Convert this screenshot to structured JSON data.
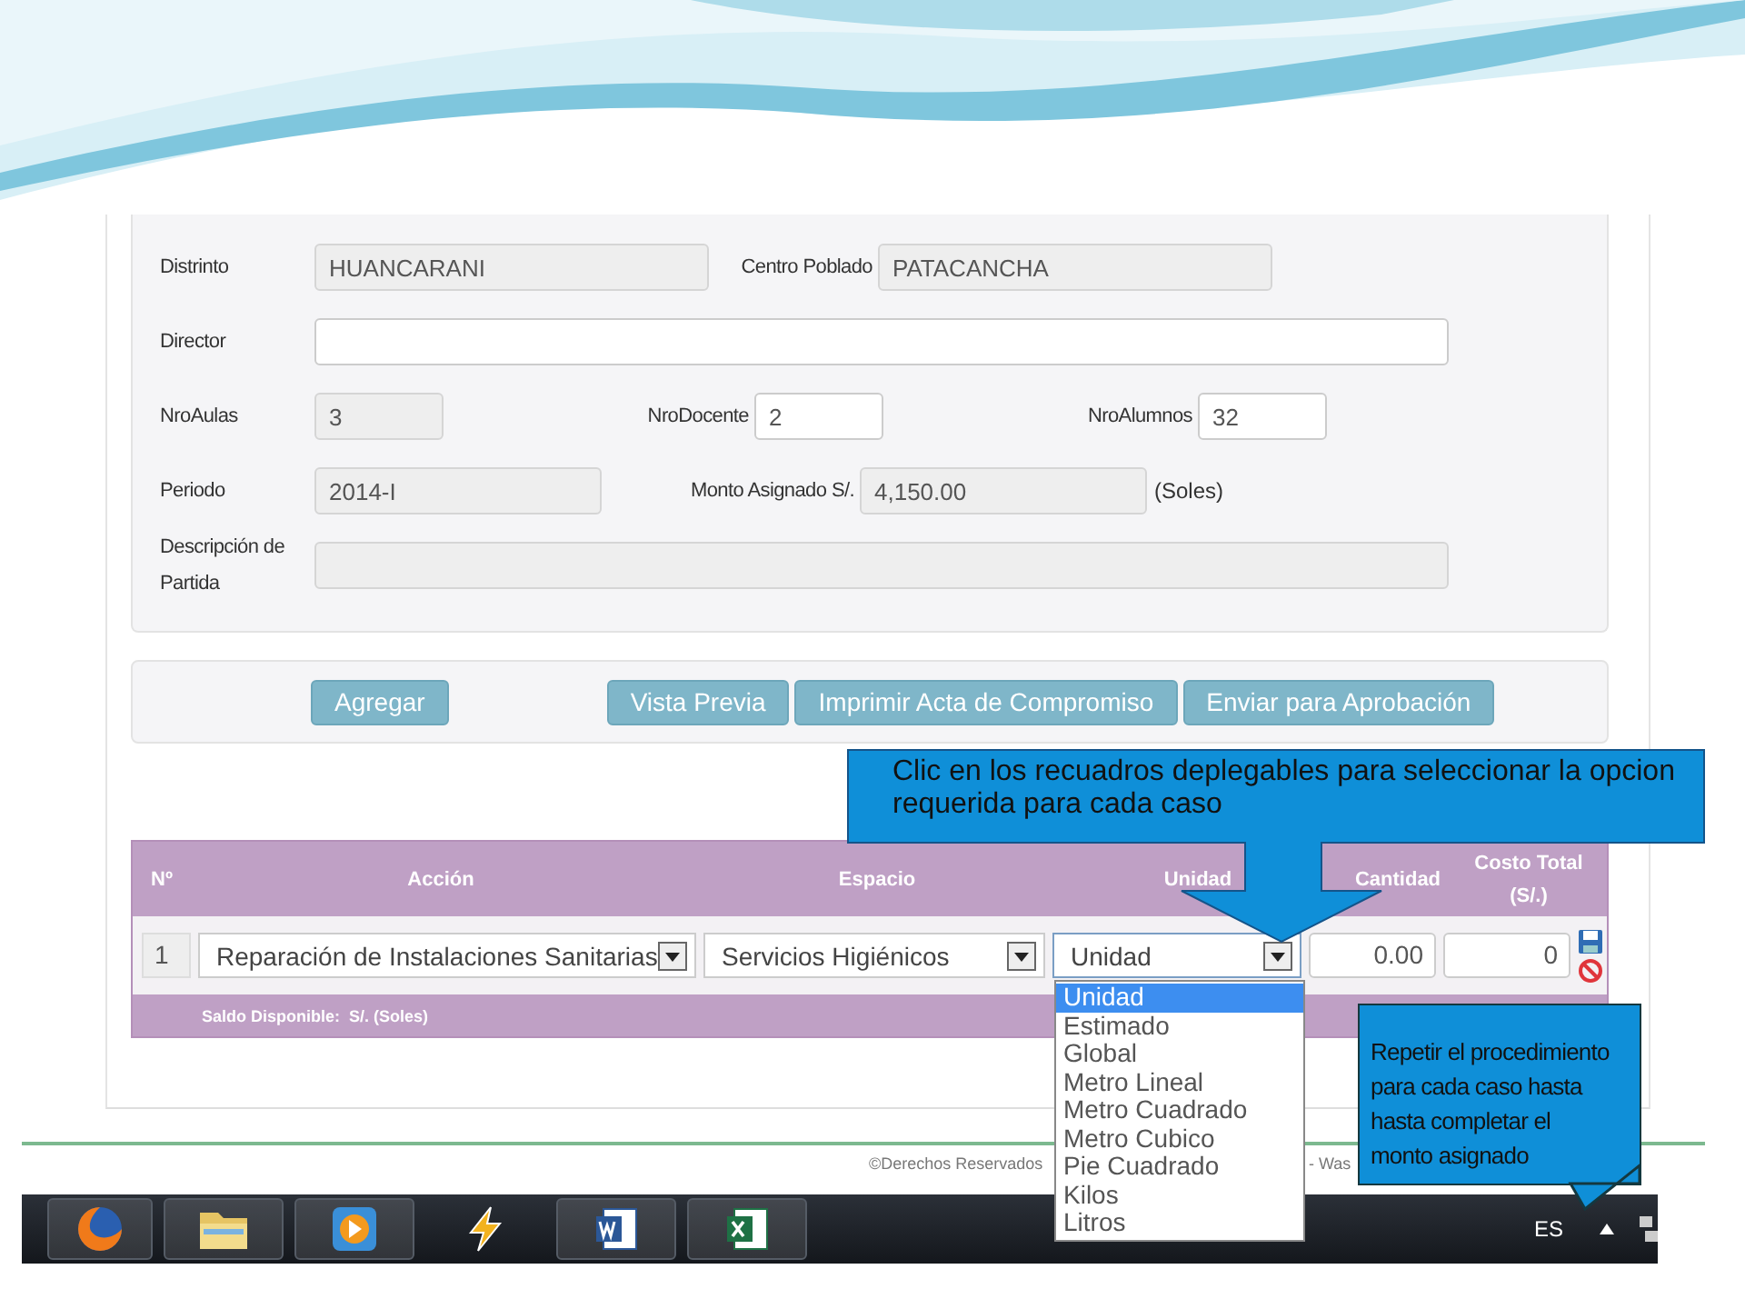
{
  "form": {
    "rows": [
      [
        {
          "label": "Distrinto",
          "value": "HUANCARANI",
          "readonly": true
        },
        {
          "label": "Centro Poblado",
          "value": "PATACANCHA",
          "readonly": true
        }
      ],
      [
        {
          "label": "Director",
          "readonly": false
        }
      ],
      [
        {
          "label": "NroAulas",
          "value": "3",
          "readonly": true
        },
        {
          "label": "NroDocente",
          "value": "2",
          "readonly": false
        },
        {
          "label": "NroAlumnos",
          "value": "32",
          "readonly": false
        }
      ],
      [
        {
          "label": "Periodo",
          "value": "2014-I",
          "readonly": true
        },
        {
          "label": "Monto Asignado S/.",
          "value": "4,150.00",
          "readonly": true,
          "suffix": "(Soles)"
        }
      ],
      [
        {
          "label": "Descripción de Partida",
          "readonly": true
        }
      ]
    ]
  },
  "buttons": [
    {
      "label": "Agregar"
    },
    {
      "label": "Vista Previa"
    },
    {
      "label": "Imprimir Acta de Compromiso"
    },
    {
      "label": "Enviar para Aprobación"
    }
  ],
  "table": {
    "columns": [
      "Nº",
      "Acción",
      "Espacio",
      "Unidad",
      "Cantidad",
      "Costo Total (S/.)"
    ],
    "row": {
      "number": "1",
      "accion": "Reparación de Instalaciones Sanitarias",
      "espacio": "Servicios Higiénicos",
      "unidad": "Unidad",
      "cantidad": "0.00",
      "costo": "0"
    },
    "saldo": "Saldo Disponible:  S/. (Soles)"
  },
  "dropdown": {
    "options": [
      {
        "label": "Unidad",
        "selected": true
      },
      {
        "label": "Estimado",
        "selected": false
      },
      {
        "label": "Global",
        "selected": false
      },
      {
        "label": "Metro Lineal",
        "selected": false
      },
      {
        "label": "Metro Cuadrado",
        "selected": false
      },
      {
        "label": "Metro Cubico",
        "selected": false
      },
      {
        "label": "Pie Cuadrado",
        "selected": false
      },
      {
        "label": "Kilos",
        "selected": false
      },
      {
        "label": "Litros",
        "selected": false
      }
    ]
  },
  "callouts": [
    "Clic en los recuadros deplegables para seleccionar la opcion requerida para cada caso",
    "Repetir el procedimiento para cada caso hasta hasta completar el monto asignado"
  ],
  "footer": [
    "©Derechos Reservados",
    "- Was"
  ],
  "taskbar": {
    "language": "ES"
  }
}
